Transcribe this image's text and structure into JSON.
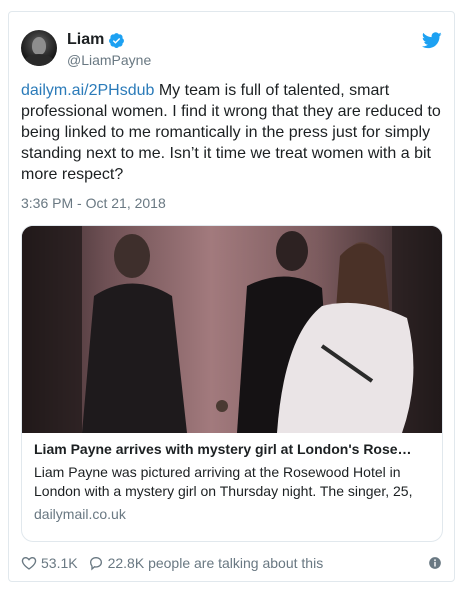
{
  "tweet": {
    "display_name": "Liam",
    "handle": "@LiamPayne",
    "link_text": "dailym.ai/2PHsdub",
    "text": " My team is full of talented, smart professional women. I find it wrong that they are reduced to being linked to me romantically in the press just for simply standing next to me. Isn’t it time we treat women with a bit more respect?",
    "timestamp": "3:36 PM - Oct 21, 2018"
  },
  "card": {
    "title": "Liam Payne arrives with mystery girl at London's Rose…",
    "description": "Liam Payne was pictured arriving at the Rosewood Hotel in London with a mystery girl on Thursday night. The singer, 25,",
    "domain": "dailymail.co.uk"
  },
  "actions": {
    "likes": "53.1K",
    "replies_text": "22.8K people are talking about this"
  },
  "icons": {
    "verified": "verified-badge-icon",
    "brand": "twitter-bird-icon",
    "like": "heart-icon",
    "reply": "speech-bubble-icon",
    "info": "info-icon"
  },
  "colors": {
    "link": "#2b7bb9",
    "brand": "#1da1f2",
    "muted": "#697882",
    "text": "#1c2022",
    "border": "#e1e8ed"
  }
}
